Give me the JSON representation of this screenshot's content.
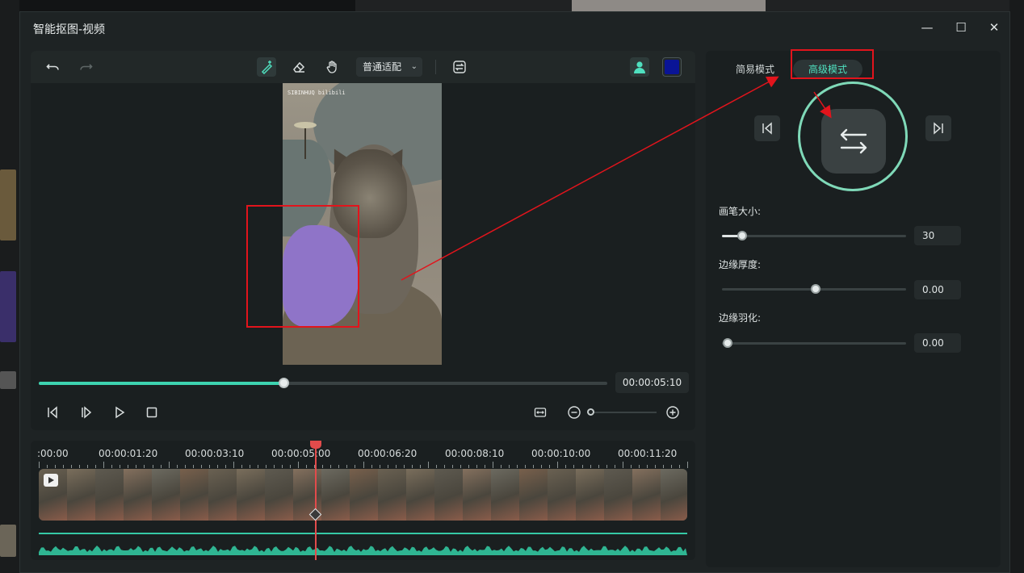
{
  "dialog": {
    "title": "智能抠图-视频",
    "window_controls": {
      "minimize": "—",
      "maximize": "☐",
      "close": "✕"
    }
  },
  "toolbar": {
    "icons": [
      "undo-icon",
      "redo-icon",
      "smart-brush-icon",
      "eraser-icon",
      "hand-icon",
      "person-icon",
      "swap-icon"
    ],
    "fit_label": "普通适配",
    "overlay_color": "#0a1496"
  },
  "preview": {
    "watermark": "SIBINHUQ bilibili",
    "progress_fraction": 0.43,
    "timecode": "00:00:05:10"
  },
  "timeline": {
    "ruler_labels": [
      ":00:00",
      "00:00:01:20",
      "00:00:03:10",
      "00:00:05:00",
      "00:00:06:20",
      "00:00:08:10",
      "00:00:10:00",
      "00:00:11:20"
    ],
    "playhead_time": "00:00:05:00"
  },
  "right_panel": {
    "tabs": {
      "simple": "简易模式",
      "advanced": "高级模式"
    },
    "active_tab": "advanced",
    "brush_size": {
      "label": "画笔大小:",
      "value": "30",
      "fraction": 0.11
    },
    "edge_thickness": {
      "label": "边缘厚度:",
      "value": "0.00",
      "fraction": 0.51
    },
    "edge_feather": {
      "label": "边缘羽化:",
      "value": "0.00",
      "fraction": 0.03
    }
  },
  "colors": {
    "accent": "#3dd3b0",
    "annotation": "#e2141c",
    "playhead": "#e24b4b"
  }
}
